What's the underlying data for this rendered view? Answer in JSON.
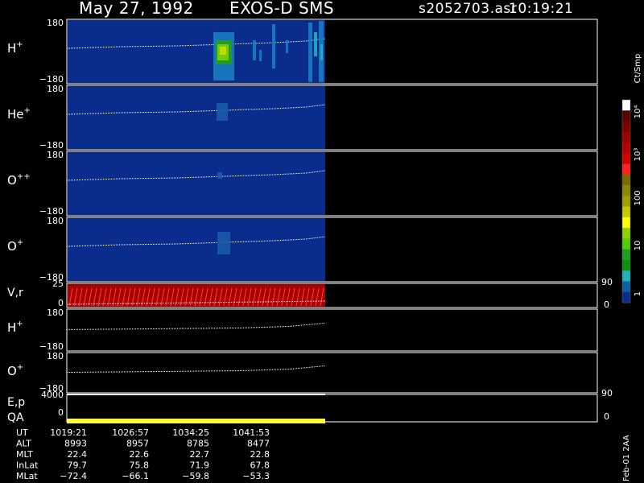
{
  "header": {
    "date": "May 27, 1992",
    "instrument": "EXOS-D SMS",
    "file": "s2052703.asr",
    "time": "10:19:21"
  },
  "panels": [
    {
      "label": "H",
      "sup": "+",
      "ymax": "180",
      "ymin": "−180"
    },
    {
      "label": "He",
      "sup": "+",
      "ymax": "180",
      "ymin": "−180"
    },
    {
      "label": "O",
      "sup": "++",
      "ymax": "180",
      "ymin": "−180"
    },
    {
      "label": "O",
      "sup": "+",
      "ymax": "180",
      "ymin": "−180"
    }
  ],
  "vr_panel": {
    "label": "V,r",
    "ymax": "25",
    "ymin": "0",
    "rmax": "90",
    "rmin": "0"
  },
  "line_panels": [
    {
      "label": "H",
      "sup": "+",
      "ymax": "180",
      "ymin": "−180"
    },
    {
      "label": "O",
      "sup": "+",
      "ymax": "180",
      "ymin": "−180"
    }
  ],
  "ep_panel": {
    "label": "E,p",
    "ymax": "4000",
    "ymin": "0",
    "rmax": "90",
    "rmin": "0"
  },
  "qa_label": "QA",
  "colorbar": {
    "unit": "Ct/Smp",
    "labels": [
      "10⁴",
      "10³",
      "100",
      "10",
      "1"
    ],
    "colors": [
      "#ffffff",
      "#5a0000",
      "#7a0000",
      "#9a0000",
      "#b40000",
      "#d00000",
      "#ff2020",
      "#7a6a00",
      "#8a8a00",
      "#a0a000",
      "#c8c800",
      "#ffff00",
      "#90d000",
      "#50d000",
      "#20a020",
      "#109010",
      "#20b0c0",
      "#1060a0",
      "#0a2c8c"
    ]
  },
  "footer": {
    "rows": [
      {
        "label": "UT",
        "values": [
          "1019:21",
          "1026:57",
          "1034:25",
          "1041:53"
        ]
      },
      {
        "label": "ALT",
        "values": [
          "8993",
          "8957",
          "8785",
          "8477"
        ]
      },
      {
        "label": "MLT",
        "values": [
          "22.4",
          "22.6",
          "22.7",
          "22.8"
        ]
      },
      {
        "label": "InLat",
        "values": [
          "79.7",
          "75.8",
          "71.9",
          "67.8"
        ]
      },
      {
        "label": "MLat",
        "values": [
          "−72.4",
          "−66.1",
          "−59.8",
          "−53.3"
        ]
      }
    ],
    "stamp": "Feb-01 2AA"
  },
  "chart_data": {
    "type": "heatmap",
    "title": "May 27, 1992   EXOS-D SMS",
    "x": [
      "1019:21",
      "1026:57",
      "1034:25",
      "1041:53"
    ],
    "series": [
      {
        "name": "H+",
        "ylim": [
          -180,
          180
        ]
      },
      {
        "name": "He+",
        "ylim": [
          -180,
          180
        ]
      },
      {
        "name": "O++",
        "ylim": [
          -180,
          180
        ]
      },
      {
        "name": "O+",
        "ylim": [
          -180,
          180
        ]
      },
      {
        "name": "V,r",
        "ylim": [
          0,
          25
        ]
      },
      {
        "name": "E,p",
        "ylim": [
          0,
          4000
        ]
      }
    ],
    "colorscale": {
      "unit": "Ct/Smp",
      "log": true,
      "range": [
        1,
        10000
      ]
    },
    "grid": false,
    "legend": "right"
  }
}
